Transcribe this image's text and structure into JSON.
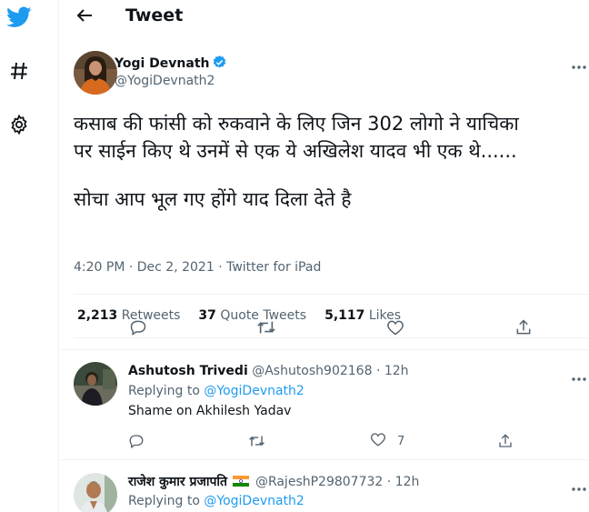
{
  "header": {
    "title": "Tweet"
  },
  "tweet": {
    "author_name": "Yogi Devnath",
    "author_handle": "@YogiDevnath2",
    "text_lines": [
      "कसाब की फांसी को रुकवाने के लिए जिन 302 लोगो ने याचिका",
      "पर साईन किए थे उनमें से एक ये अखिलेश यादव भी एक थे......",
      "सोचा आप भूल गए होंगे याद दिला देते है"
    ],
    "timestamp": "4:20 PM · Dec 2, 2021 · Twitter for iPad",
    "retweets_count": "2,213",
    "retweets_label": "Retweets",
    "quotes_count": "37",
    "quotes_label": "Quote Tweets",
    "likes_count": "5,117",
    "likes_label": "Likes"
  },
  "replies": [
    {
      "name": "Ashutosh Trivedi",
      "handle": "@Ashutosh902168",
      "time": "· 12h",
      "replying_label": "Replying to",
      "replying_to": "@YogiDevnath2",
      "text": "Shame on Akhilesh Yadav",
      "like_count": "7"
    },
    {
      "name": "राजेश कुमार प्रजापति",
      "handle": "@RajeshP29807732",
      "time": "· 12h",
      "replying_label": "Replying to",
      "replying_to": "@YogiDevnath2"
    }
  ],
  "icons": {
    "twitter": "twitter-bird-icon",
    "explore": "hashtag-icon",
    "settings": "gear-icon",
    "back": "back-arrow-icon",
    "verified": "verified-badge-icon",
    "more": "more-dots-icon",
    "reply": "reply-icon",
    "retweet": "retweet-icon",
    "like": "heart-icon",
    "share": "share-icon",
    "flag": "india-flag-icon"
  },
  "colors": {
    "brand": "#1d9bf0",
    "text": "#0f1419",
    "muted": "#536471",
    "border": "#eff3f4"
  }
}
